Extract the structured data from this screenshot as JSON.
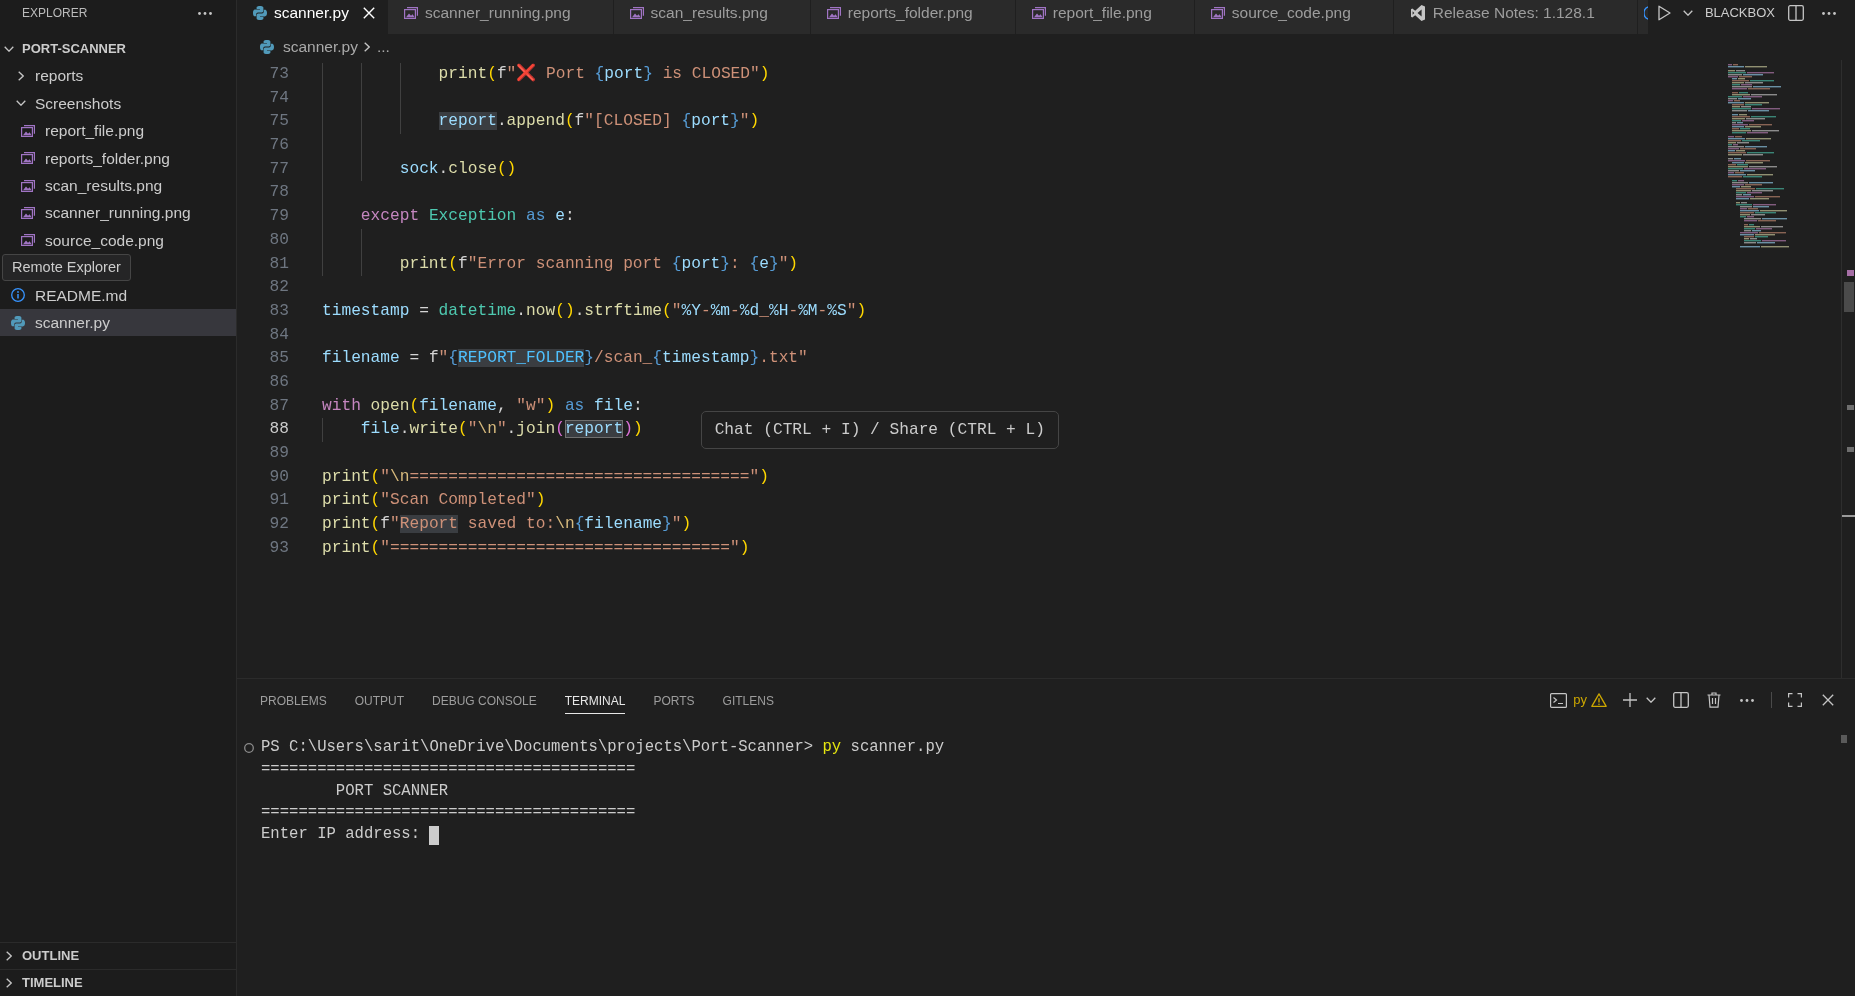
{
  "sidebar": {
    "title": "EXPLORER",
    "root": {
      "label": "PORT-SCANNER",
      "expanded": true,
      "children": [
        {
          "kind": "folder",
          "label": "reports",
          "expanded": false,
          "selected": false
        },
        {
          "kind": "folder",
          "label": "Screenshots",
          "expanded": true,
          "selected": false,
          "children": [
            {
              "kind": "image",
              "label": "report_file.png",
              "selected": false
            },
            {
              "kind": "image",
              "label": "reports_folder.png",
              "selected": false
            },
            {
              "kind": "image",
              "label": "scan_results.png",
              "selected": false
            },
            {
              "kind": "image",
              "label": "scanner_running.png",
              "selected": false
            },
            {
              "kind": "image",
              "label": "source_code.png",
              "selected": false
            }
          ]
        },
        {
          "kind": "info",
          "label": "README.md",
          "selected": false
        },
        {
          "kind": "python",
          "label": "scanner.py",
          "selected": true
        }
      ]
    },
    "tooltip": "Remote Explorer",
    "sections": [
      {
        "label": "OUTLINE",
        "expanded": false
      },
      {
        "label": "TIMELINE",
        "expanded": false
      }
    ]
  },
  "editor": {
    "tabs": [
      {
        "kind": "python",
        "label": "scanner.py",
        "selected": true
      },
      {
        "kind": "image",
        "label": "scanner_running.png",
        "selected": false
      },
      {
        "kind": "image",
        "label": "scan_results.png",
        "selected": false
      },
      {
        "kind": "image",
        "label": "reports_folder.png",
        "selected": false
      },
      {
        "kind": "image",
        "label": "report_file.png",
        "selected": false
      },
      {
        "kind": "image",
        "label": "source_code.png",
        "selected": false
      },
      {
        "kind": "release",
        "label": "Release Notes: 1.128.1",
        "selected": false
      },
      {
        "kind": "cut",
        "selected": false
      }
    ],
    "toolbar_label": "BLACKBOX",
    "breadcrumb": [
      {
        "kind": "python",
        "text": "scanner.py"
      },
      {
        "kind": "more",
        "text": "..."
      }
    ],
    "lines": [
      {
        "number": "73",
        "current": false,
        "segments": [
          {
            "kind": "fn",
            "text": "            print"
          },
          {
            "kind": "b1",
            "text": "("
          },
          {
            "kind": "prefix",
            "text": "f"
          },
          {
            "kind": "str",
            "text": "\""
          },
          {
            "kind": "emoji",
            "text": "❌"
          },
          {
            "kind": "str",
            "text": " Port "
          },
          {
            "kind": "brace",
            "text": "{"
          },
          {
            "kind": "var",
            "text": "port"
          },
          {
            "kind": "brace",
            "text": "}"
          },
          {
            "kind": "str",
            "text": " is CLOSED\""
          },
          {
            "kind": "b1",
            "text": ")"
          }
        ]
      },
      {
        "number": "74",
        "current": false
      },
      {
        "number": "75",
        "current": false,
        "segments": [
          {
            "kind": "var",
            "text": "            report",
            "highlighted": true
          },
          {
            "kind": "plain",
            "text": "."
          },
          {
            "kind": "fn",
            "text": "append"
          },
          {
            "kind": "b1",
            "text": "("
          },
          {
            "kind": "prefix",
            "text": "f"
          },
          {
            "kind": "str",
            "text": "\"[CLOSED] "
          },
          {
            "kind": "brace",
            "text": "{"
          },
          {
            "kind": "var",
            "text": "port"
          },
          {
            "kind": "brace",
            "text": "}"
          },
          {
            "kind": "str",
            "text": "\""
          },
          {
            "kind": "b1",
            "text": ")"
          }
        ]
      },
      {
        "number": "76",
        "current": false
      },
      {
        "number": "77",
        "current": false,
        "segments": [
          {
            "kind": "var",
            "text": "        sock"
          },
          {
            "kind": "plain",
            "text": "."
          },
          {
            "kind": "fn",
            "text": "close"
          },
          {
            "kind": "b1",
            "text": "()"
          }
        ]
      },
      {
        "number": "78",
        "current": false
      },
      {
        "number": "79",
        "current": false,
        "segments": [
          {
            "kind": "kw",
            "text": "    except "
          },
          {
            "kind": "type",
            "text": "Exception "
          },
          {
            "kind": "sto",
            "text": "as "
          },
          {
            "kind": "var",
            "text": "e"
          },
          {
            "kind": "plain",
            "text": ":"
          }
        ]
      },
      {
        "number": "80",
        "current": false
      },
      {
        "number": "81",
        "current": false,
        "segments": [
          {
            "kind": "fn",
            "text": "        print"
          },
          {
            "kind": "b1",
            "text": "("
          },
          {
            "kind": "prefix",
            "text": "f"
          },
          {
            "kind": "str",
            "text": "\"Error scanning port "
          },
          {
            "kind": "brace",
            "text": "{"
          },
          {
            "kind": "var",
            "text": "port"
          },
          {
            "kind": "brace",
            "text": "}"
          },
          {
            "kind": "str",
            "text": ": "
          },
          {
            "kind": "brace",
            "text": "{"
          },
          {
            "kind": "var",
            "text": "e"
          },
          {
            "kind": "brace",
            "text": "}"
          },
          {
            "kind": "str",
            "text": "\""
          },
          {
            "kind": "b1",
            "text": ")"
          }
        ]
      },
      {
        "number": "82",
        "current": false
      },
      {
        "number": "83",
        "current": false,
        "segments": [
          {
            "kind": "var",
            "text": "timestamp"
          },
          {
            "kind": "plain",
            "text": " = "
          },
          {
            "kind": "type",
            "text": "datetime"
          },
          {
            "kind": "plain",
            "text": "."
          },
          {
            "kind": "fn",
            "text": "now"
          },
          {
            "kind": "b1",
            "text": "()"
          },
          {
            "kind": "plain",
            "text": "."
          },
          {
            "kind": "fn",
            "text": "strftime"
          },
          {
            "kind": "b1",
            "text": "("
          },
          {
            "kind": "str",
            "text": "\""
          },
          {
            "kind": "fmt",
            "text": "%Y"
          },
          {
            "kind": "str",
            "text": "-"
          },
          {
            "kind": "fmt",
            "text": "%m"
          },
          {
            "kind": "str",
            "text": "-"
          },
          {
            "kind": "fmt",
            "text": "%d"
          },
          {
            "kind": "str",
            "text": "_"
          },
          {
            "kind": "fmt",
            "text": "%H"
          },
          {
            "kind": "str",
            "text": "-"
          },
          {
            "kind": "fmt",
            "text": "%M"
          },
          {
            "kind": "str",
            "text": "-"
          },
          {
            "kind": "fmt",
            "text": "%S"
          },
          {
            "kind": "str",
            "text": "\""
          },
          {
            "kind": "b1",
            "text": ")"
          }
        ]
      },
      {
        "number": "84",
        "current": false
      },
      {
        "number": "85",
        "current": false,
        "segments": [
          {
            "kind": "var",
            "text": "filename"
          },
          {
            "kind": "plain",
            "text": " = "
          },
          {
            "kind": "prefix",
            "text": "f"
          },
          {
            "kind": "str",
            "text": "\""
          },
          {
            "kind": "brace",
            "text": "{"
          },
          {
            "kind": "const",
            "text": "REPORT_FOLDER",
            "highlighted": true
          },
          {
            "kind": "brace",
            "text": "}"
          },
          {
            "kind": "str",
            "text": "/scan_"
          },
          {
            "kind": "brace",
            "text": "{"
          },
          {
            "kind": "var",
            "text": "timestamp"
          },
          {
            "kind": "brace",
            "text": "}"
          },
          {
            "kind": "str",
            "text": ".txt\""
          }
        ]
      },
      {
        "number": "86",
        "current": false
      },
      {
        "number": "87",
        "current": false,
        "segments": [
          {
            "kind": "kw",
            "text": "with "
          },
          {
            "kind": "fn",
            "text": "open"
          },
          {
            "kind": "b1",
            "text": "("
          },
          {
            "kind": "var",
            "text": "filename"
          },
          {
            "kind": "plain",
            "text": ", "
          },
          {
            "kind": "str",
            "text": "\"w\""
          },
          {
            "kind": "b1",
            "text": ") "
          },
          {
            "kind": "sto",
            "text": "as "
          },
          {
            "kind": "var",
            "text": "file"
          },
          {
            "kind": "plain",
            "text": ":"
          }
        ]
      },
      {
        "number": "88",
        "current": true,
        "segments": [
          {
            "kind": "var",
            "text": "    file"
          },
          {
            "kind": "plain",
            "text": "."
          },
          {
            "kind": "fn",
            "text": "write"
          },
          {
            "kind": "b1",
            "text": "("
          },
          {
            "kind": "str",
            "text": "\""
          },
          {
            "kind": "esc",
            "text": "\\n"
          },
          {
            "kind": "str",
            "text": "\""
          },
          {
            "kind": "plain",
            "text": "."
          },
          {
            "kind": "fn",
            "text": "join"
          },
          {
            "kind": "b2",
            "text": "("
          },
          {
            "kind": "var",
            "text": "report",
            "highlighted": true
          },
          {
            "kind": "b2",
            "text": ")"
          },
          {
            "kind": "b1",
            "text": ")"
          }
        ]
      },
      {
        "number": "89",
        "current": false
      },
      {
        "number": "90",
        "current": false,
        "segments": [
          {
            "kind": "fn",
            "text": "print"
          },
          {
            "kind": "b1",
            "text": "("
          },
          {
            "kind": "str",
            "text": "\""
          },
          {
            "kind": "esc",
            "text": "\\n"
          },
          {
            "kind": "str",
            "text": "===================================\""
          },
          {
            "kind": "b1",
            "text": ")"
          }
        ]
      },
      {
        "number": "91",
        "current": false,
        "segments": [
          {
            "kind": "fn",
            "text": "print"
          },
          {
            "kind": "b1",
            "text": "("
          },
          {
            "kind": "str",
            "text": "\"Scan Completed\""
          },
          {
            "kind": "b1",
            "text": ")"
          }
        ]
      },
      {
        "number": "92",
        "current": false,
        "segments": [
          {
            "kind": "fn",
            "text": "print"
          },
          {
            "kind": "b1",
            "text": "("
          },
          {
            "kind": "prefix",
            "text": "f"
          },
          {
            "kind": "str",
            "text": "\""
          },
          {
            "kind": "str",
            "text": "Report",
            "highlighted": true
          },
          {
            "kind": "str",
            "text": " saved to:"
          },
          {
            "kind": "esc",
            "text": "\\n"
          },
          {
            "kind": "brace",
            "text": "{"
          },
          {
            "kind": "var",
            "text": "filename"
          },
          {
            "kind": "brace",
            "text": "}"
          },
          {
            "kind": "str",
            "text": "\""
          },
          {
            "kind": "b1",
            "text": ")"
          }
        ]
      },
      {
        "number": "93",
        "current": false,
        "segments": [
          {
            "kind": "fn",
            "text": "print"
          },
          {
            "kind": "b1",
            "text": "("
          },
          {
            "kind": "str",
            "text": "\"===================================\""
          },
          {
            "kind": "b1",
            "text": ")"
          }
        ]
      }
    ],
    "hint": "Chat (CTRL + I) / Share (CTRL + L)"
  },
  "panel": {
    "tabs": [
      {
        "label": "PROBLEMS",
        "selected": false
      },
      {
        "label": "OUTPUT",
        "selected": false
      },
      {
        "label": "DEBUG CONSOLE",
        "selected": false
      },
      {
        "label": "TERMINAL",
        "selected": true
      },
      {
        "label": "PORTS",
        "selected": false
      },
      {
        "label": "GITLENS",
        "selected": false
      }
    ],
    "terminal": {
      "name": "py",
      "warning": true,
      "lines": [
        {
          "kind": "command",
          "cursor": false,
          "segments": [
            {
              "kind": "plain",
              "text": "PS C:\\Users\\sarit\\OneDrive\\Documents\\projects\\Port-Scanner> "
            },
            {
              "kind": "command",
              "text": "py"
            },
            {
              "kind": "plain",
              "text": " scanner.py"
            }
          ]
        },
        {
          "kind": "output",
          "cursor": false,
          "segments": [
            {
              "kind": "plain",
              "text": "========================================"
            }
          ]
        },
        {
          "kind": "output",
          "cursor": false,
          "segments": [
            {
              "kind": "plain",
              "text": "        PORT SCANNER"
            }
          ]
        },
        {
          "kind": "output",
          "cursor": false,
          "segments": [
            {
              "kind": "plain",
              "text": "========================================"
            }
          ]
        },
        {
          "kind": "output",
          "cursor": true,
          "segments": [
            {
              "kind": "plain",
              "text": "Enter IP address:"
            }
          ]
        }
      ]
    }
  }
}
